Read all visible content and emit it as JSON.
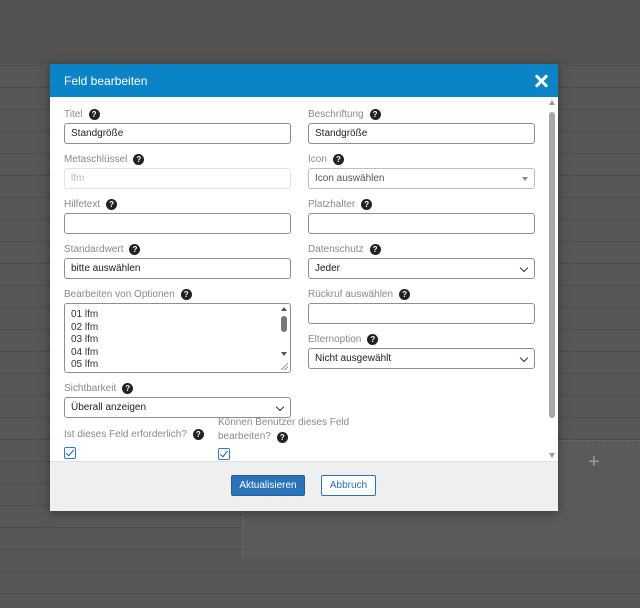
{
  "modal": {
    "title": "Feld bearbeiten",
    "close_icon": "close-icon"
  },
  "form": {
    "titel": {
      "label": "Titel",
      "value": "Standgröße"
    },
    "beschriftung": {
      "label": "Beschriftung",
      "value": "Standgröße"
    },
    "metaschluessel": {
      "label": "Metaschlüssel",
      "value": "lfm"
    },
    "icon": {
      "label": "Icon",
      "value": "Icon auswählen"
    },
    "hilfetext": {
      "label": "Hilfetext",
      "value": ""
    },
    "platzhalter": {
      "label": "Platzhalter",
      "value": ""
    },
    "standardwert": {
      "label": "Standardwert",
      "value": "bitte auswählen"
    },
    "datenschutz": {
      "label": "Datenschutz",
      "value": "Jeder"
    },
    "optionen": {
      "label": "Bearbeiten von Optionen",
      "lines": [
        "01 lfm",
        "02 lfm",
        "03 lfm",
        "04 lfm",
        "05 lfm"
      ]
    },
    "rueckruf": {
      "label": "Rückruf auswählen",
      "value": ""
    },
    "elternoption": {
      "label": "Elternoption",
      "value": "Nicht ausgewählt"
    },
    "sichtbarkeit": {
      "label": "Sichtbarkeit",
      "value": "Überall anzeigen"
    },
    "erforderlich": {
      "label": "Ist dieses Feld erforderlich?",
      "checked": true
    },
    "benutzer_bearbeiten": {
      "label_line1": "Können Benutzer dieses Feld",
      "label_line2": "bearbeiten?",
      "checked": true
    }
  },
  "footer": {
    "update_label": "Aktualisieren",
    "cancel_label": "Abbruch"
  },
  "background": {
    "add_icon": "plus-icon"
  },
  "colors": {
    "header": "#0a84c6",
    "primary_button": "#2a73b8"
  }
}
